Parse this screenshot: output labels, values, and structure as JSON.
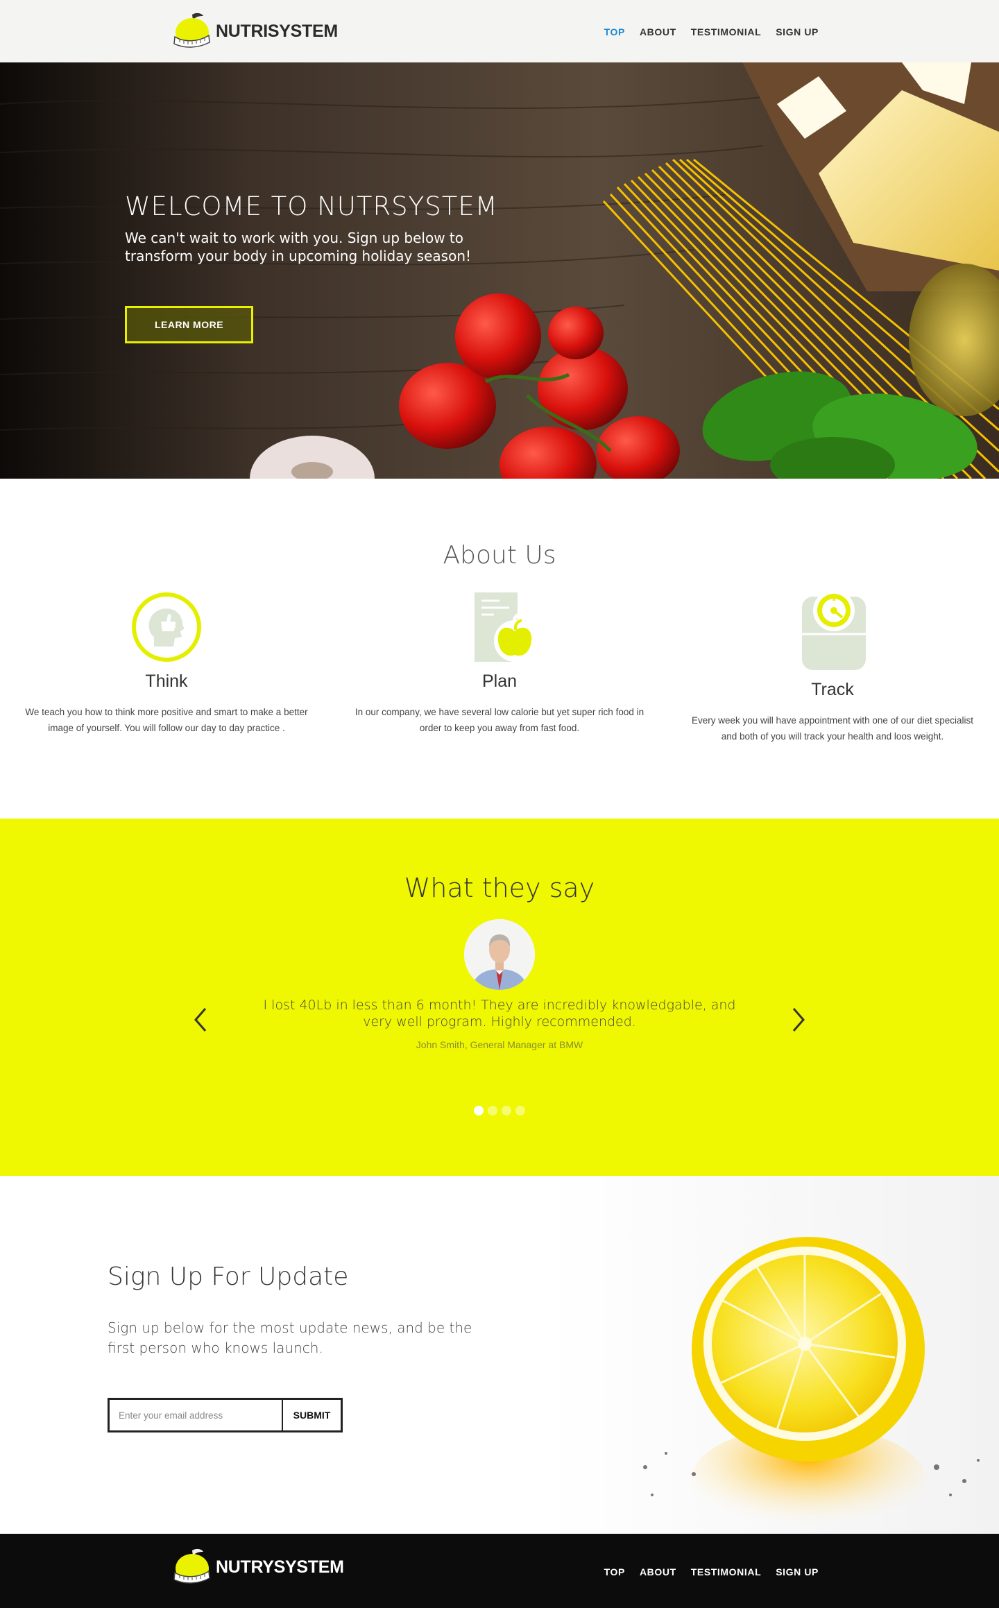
{
  "brand": {
    "name": "NUTRISYSTEM",
    "footer_name": "NUTRYSYSTEM"
  },
  "nav": {
    "items": [
      {
        "label": "TOP"
      },
      {
        "label": "ABOUT"
      },
      {
        "label": "TESTIMONIAL"
      },
      {
        "label": "SIGN UP"
      }
    ],
    "active": "TOP"
  },
  "hero": {
    "title": "WELCOME TO NUTRSYSTEM",
    "subtitle": "We can't wait to work with you. Sign up below to transform your body in upcoming holiday season!",
    "button": "LEARN MORE"
  },
  "about": {
    "title": "About Us",
    "features": [
      {
        "icon": "thumbs-up-head-icon",
        "title": "Think",
        "text": "We teach you how to think more positive and smart to make a better image of yourself. You will follow our day to day practice ."
      },
      {
        "icon": "document-apple-icon",
        "title": "Plan",
        "text": "In our company, we have several low calorie but yet super rich food in order to keep you away from fast food."
      },
      {
        "icon": "scale-icon",
        "title": "Track",
        "text": "Every week you will have appointment with one of our diet specialist and both of you will track your health and loos weight."
      }
    ]
  },
  "testimonial": {
    "title": "What they say",
    "quote": "I lost 40Lb in less than 6 month! They are incredibly knowledgable, and very well program. Highly recommended.",
    "author": "John Smith, General Manager at BMW",
    "slide_count": 4,
    "active_slide": 1
  },
  "signup": {
    "title": "Sign Up For Update",
    "text": "Sign up below for the most update news, and be the first person who knows launch.",
    "placeholder": "Enter your email address",
    "button": "SUBMIT"
  },
  "footer": {
    "items": [
      {
        "label": "TOP"
      },
      {
        "label": "ABOUT"
      },
      {
        "label": "TESTIMONIAL"
      },
      {
        "label": "SIGN UP"
      }
    ]
  },
  "colors": {
    "accent_yellow": "#eff800",
    "nav_active": "#1e88d0",
    "icon_green": "#dde6d4",
    "footer_bg": "#0c0c0c"
  }
}
